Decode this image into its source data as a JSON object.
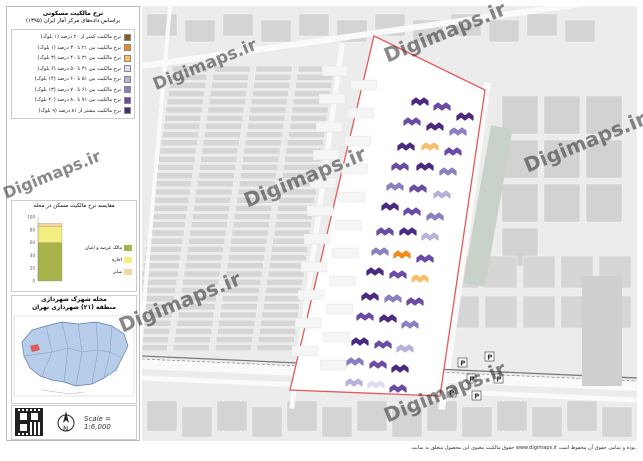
{
  "legend": {
    "title": "نرخ مالکیت مسکونی",
    "subtitle": "براساس داده‌های مرکز آمار ایران (۱۳۹۵)",
    "classes": [
      {
        "label": "نرخ مالکیت کمتر از ۲۰ درصد (۱ بلوک)",
        "color": "#8b5a2b"
      },
      {
        "label": "نرخ مالکیت بین ۲۱ تا ۳۰ درصد (۱ بلوک)",
        "color": "#f08c1e"
      },
      {
        "label": "نرخ مالکیت بین ۳۱ تا ۴۰ درصد (۳ بلوک)",
        "color": "#f9bd6e"
      },
      {
        "label": "نرخ مالکیت بین ۴۱ تا ۵۰ درصد (۶ بلوک)",
        "color": "#dcdcf0"
      },
      {
        "label": "نرخ مالکیت بین ۵۱ تا ۶۰ درصد (۱۴ بلوک)",
        "color": "#b6b2dc"
      },
      {
        "label": "نرخ مالکیت بین ۶۱ تا ۷۰ درصد (۱۳ بلوک)",
        "color": "#8a7fc0"
      },
      {
        "label": "نرخ مالکیت بین ۷۱ تا ۸۰ درصد (۲۰ بلوک)",
        "color": "#6a4ba6"
      },
      {
        "label": "نرخ مالکیت بیشتر از ۸۱ درصد (۹ بلوک)",
        "color": "#4b2a80"
      }
    ]
  },
  "chart": {
    "title": "مقایسه نرخ مالکیت مسکن در محله",
    "legend": [
      {
        "label": "مالک عرصه و اعیان",
        "color": "#a8b44a"
      },
      {
        "label": "اجاره",
        "color": "#f2ee80"
      },
      {
        "label": "سایر",
        "color": "#f6d4a0"
      }
    ]
  },
  "chart_data": {
    "type": "bar",
    "categories": [
      "محله"
    ],
    "series": [
      {
        "name": "مالک عرصه و اعیان",
        "values": [
          60
        ]
      },
      {
        "name": "اجاره",
        "values": [
          25
        ]
      },
      {
        "name": "سایر",
        "values": [
          5
        ]
      }
    ],
    "yticks": [
      "0",
      "20",
      "40",
      "60",
      "80",
      "100"
    ],
    "ylim": [
      0,
      100
    ]
  },
  "locator": {
    "title": "محله شهرک شهرداری",
    "subtitle": "منطقه (۲۱) شهرداری تهران"
  },
  "scale": {
    "text": "Scale = 1:6,000"
  },
  "watermark": "Digimaps.ir",
  "footer": "حقوق مالکیت معنوی این محصول متعلق به سایت www.digimaps.ir بوده و تمامی حقوق آن محفوظ است.",
  "colors": {
    "outline": "#e05a5a",
    "block": "#dcdcdc",
    "road": "#f2f2f2",
    "green": "#c8d2c8"
  }
}
